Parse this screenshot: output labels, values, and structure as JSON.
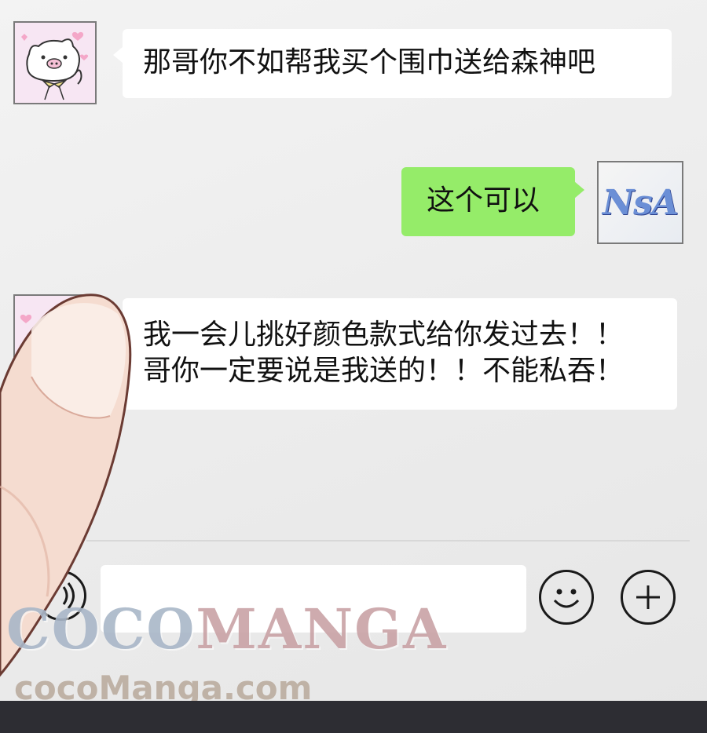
{
  "conversation": {
    "messages": [
      {
        "sender": "pig",
        "side": "left",
        "lines": [
          "那哥你不如帮我买个围巾送给森神吧"
        ]
      },
      {
        "sender": "nsa",
        "side": "right",
        "lines": [
          "这个可以"
        ]
      },
      {
        "sender": "pig",
        "side": "left",
        "lines": [
          "我一会儿挑好颜色款式给你发过去！！",
          "哥你一定要说是我送的！！不能私吞！"
        ]
      }
    ],
    "nsa_avatar_text": "NsA"
  },
  "input_bar": {
    "input_value": "",
    "voice_icon": "voice-icon",
    "emoji_icon": "emoji-smile-icon",
    "plus_icon": "plus-icon"
  },
  "watermark": {
    "brand_part1": "COCO",
    "brand_part2": "MANGA",
    "url": "cocoManga.com"
  },
  "colors": {
    "sent_bubble": "#95ec69",
    "received_bubble": "#ffffff",
    "background": "#ededed"
  }
}
